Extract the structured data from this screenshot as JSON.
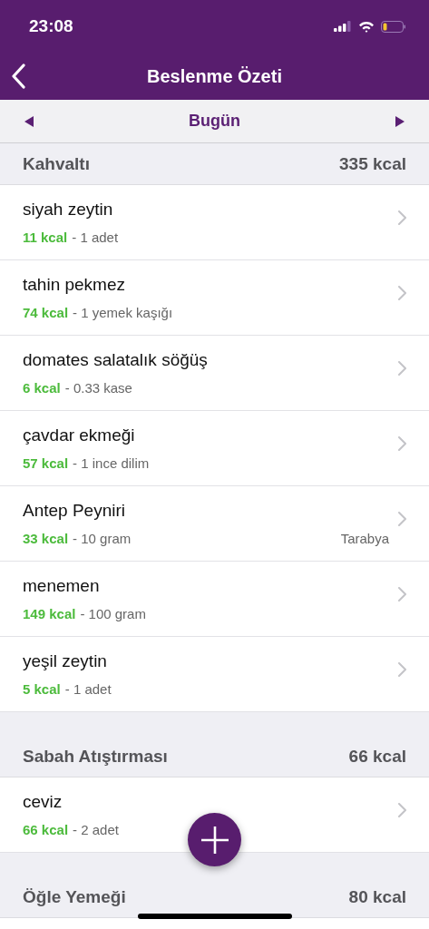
{
  "status_bar": {
    "time": "23:08"
  },
  "nav": {
    "title": "Beslenme Özeti"
  },
  "date_bar": {
    "label": "Bugün"
  },
  "sections": [
    {
      "title": "Kahvaltı",
      "total": "335 kcal",
      "items": [
        {
          "name": "siyah zeytin",
          "kcal": "11 kcal",
          "amount": "- 1 adet"
        },
        {
          "name": "tahin pekmez",
          "kcal": "74 kcal",
          "amount": "- 1 yemek kaşığı"
        },
        {
          "name": "domates salatalık söğüş",
          "kcal": "6 kcal",
          "amount": "- 0.33 kase"
        },
        {
          "name": "çavdar ekmeği",
          "kcal": "57 kcal",
          "amount": "- 1 ince dilim"
        },
        {
          "name": "Antep Peyniri",
          "kcal": "33 kcal",
          "amount": "- 10 gram",
          "brand": "Tarabya"
        },
        {
          "name": "menemen",
          "kcal": "149 kcal",
          "amount": "- 100 gram"
        },
        {
          "name": "yeşil zeytin",
          "kcal": "5 kcal",
          "amount": "- 1 adet"
        }
      ]
    },
    {
      "title": "Sabah Atıştırması",
      "total": "66 kcal",
      "items": [
        {
          "name": "ceviz",
          "kcal": "66 kcal",
          "amount": "- 2 adet"
        }
      ]
    },
    {
      "title": "Öğle Yemeği",
      "total": "80 kcal"
    }
  ]
}
